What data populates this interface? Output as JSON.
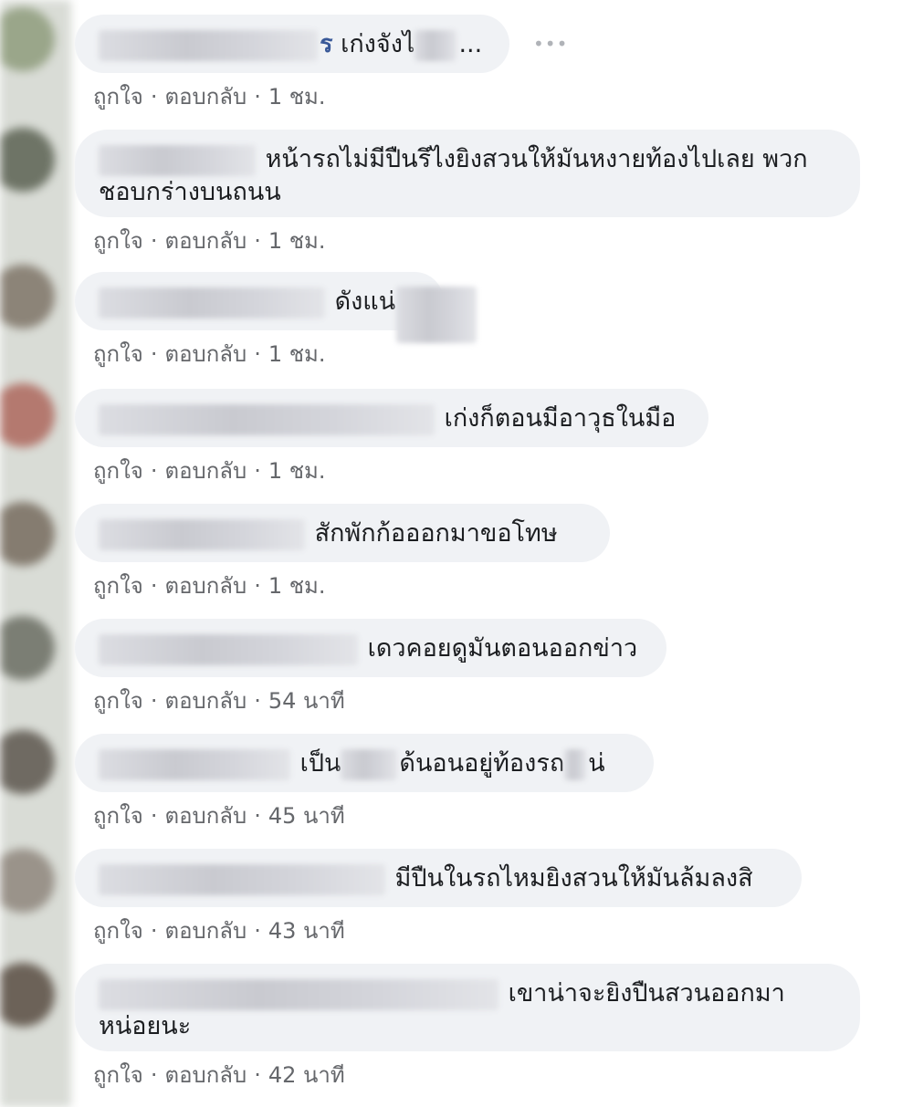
{
  "actions": {
    "like": "ถูกใจ",
    "reply": "ตอบกลับ",
    "separator": "·"
  },
  "more_icon": "more-options-icon",
  "comments": [
    {
      "author_tail": "ร",
      "text": "เก่งจังไ",
      "tail": "...",
      "time": "1 ชม."
    },
    {
      "author_tail": "",
      "text": "หน้ารถไม่มีปืนรึไงยิงสวนให้มันหงายท้องไปเลย พวกชอบกร่างบนถนน",
      "tail": "",
      "time": "1 ชม."
    },
    {
      "author_tail": "",
      "text": "ดังแน่",
      "tail": "",
      "time": "1 ชม."
    },
    {
      "author_tail": "",
      "text": "เก่งก็ตอนมีอาวุธในมือ",
      "tail": "",
      "time": "1 ชม."
    },
    {
      "author_tail": "",
      "text": "สักพักก้อออกมาขอโทษ",
      "tail": "",
      "time": "1 ชม."
    },
    {
      "author_tail": "",
      "text": "เดวคอยดูมันตอนออกข่าว",
      "tail": "",
      "time": "54 นาที"
    },
    {
      "author_tail": "",
      "text": "เป็น",
      "tail": "ด้นอนอยู่ท้องรถ",
      "tail2": "น่",
      "time": "45 นาที"
    },
    {
      "author_tail": "",
      "text": "มีปืนในรถไหมยิงสวนให้มันล้มลงสิ",
      "tail": "",
      "time": "43 นาที"
    },
    {
      "author_tail": "",
      "text": "เขาน่าจะยิงปืนสวนออกมา หน่อยนะ",
      "tail": "",
      "time": "42 นาที"
    }
  ]
}
